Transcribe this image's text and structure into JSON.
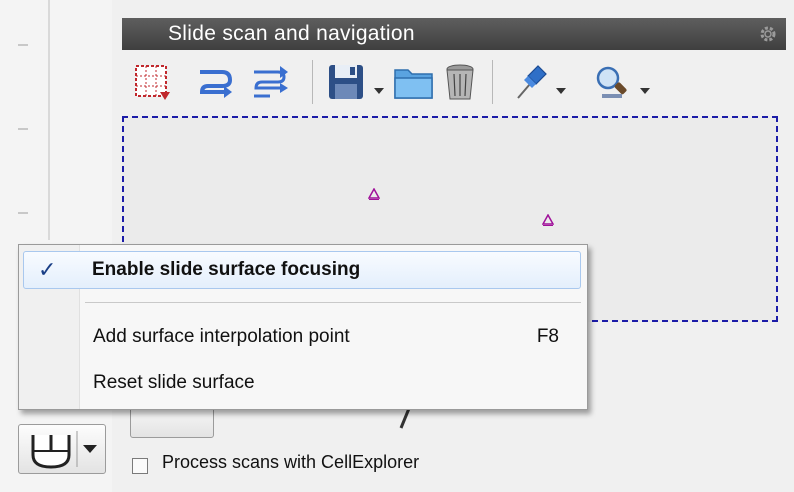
{
  "panel": {
    "title": "Slide scan and navigation",
    "settings_icon": "gear-icon"
  },
  "toolbar": {
    "buttons": [
      {
        "name": "select-region-button",
        "icon": "grid-select-icon"
      },
      {
        "name": "snake-scan-button",
        "icon": "snake-arrow-icon"
      },
      {
        "name": "multi-scan-button",
        "icon": "multi-arrow-icon"
      },
      {
        "name": "save-button",
        "icon": "floppy-disk-icon"
      },
      {
        "name": "open-folder-button",
        "icon": "folder-icon"
      },
      {
        "name": "delete-button",
        "icon": "trash-icon"
      },
      {
        "name": "pin-button",
        "icon": "pushpin-icon"
      },
      {
        "name": "find-button",
        "icon": "magnifier-icon"
      }
    ]
  },
  "context_menu": {
    "items": [
      {
        "label": "Enable slide surface focusing",
        "checked": true,
        "highlighted": true,
        "shortcut": ""
      },
      {
        "label": "Add surface interpolation point",
        "checked": false,
        "highlighted": false,
        "shortcut": "F8"
      },
      {
        "label": "Reset slide surface",
        "checked": false,
        "highlighted": false,
        "shortcut": ""
      }
    ],
    "check_mark": "✓"
  },
  "bottom": {
    "process_checkbox_label": "Process scans with CellExplorer",
    "process_checked": false
  },
  "colors": {
    "header_bg": "#4a4a4a",
    "menu_highlight": "#e4effc",
    "slide_border": "#1c1ca8",
    "marker": "#a0109a"
  }
}
